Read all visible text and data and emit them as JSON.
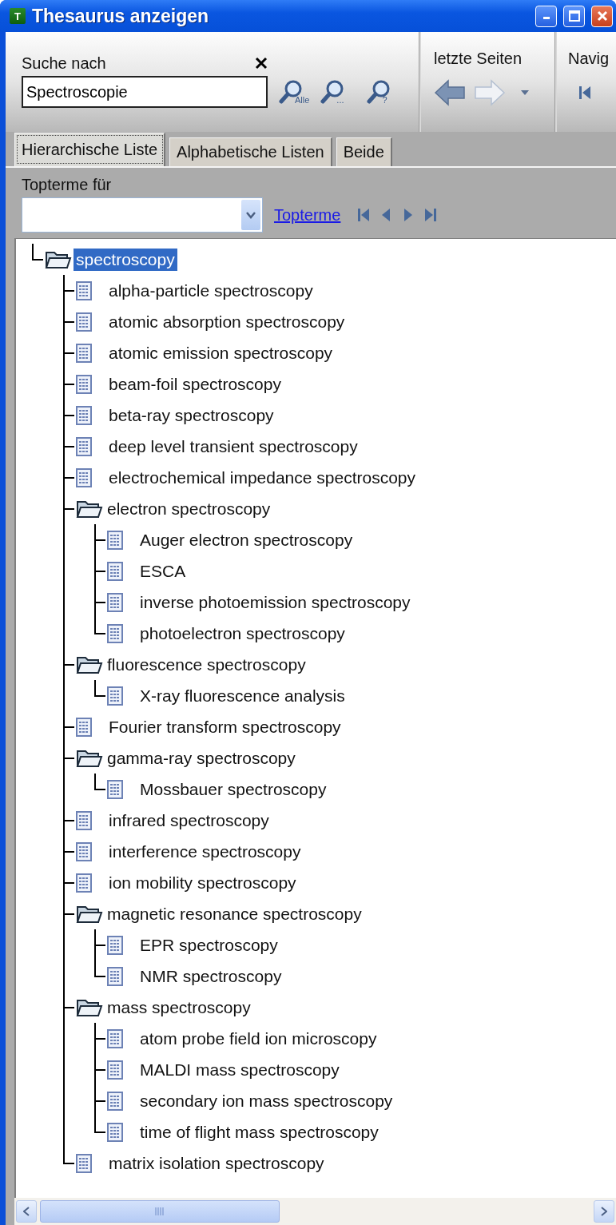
{
  "window": {
    "app_icon_letter": "T",
    "title": "Thesaurus anzeigen"
  },
  "search": {
    "label": "Suche nach",
    "value": "Spectroscopie",
    "buttons": [
      {
        "caption": "Alle"
      },
      {
        "caption": "..."
      },
      {
        "caption": "?"
      }
    ]
  },
  "recent_pages": {
    "label": "letzte Seiten",
    "back_disabled": false,
    "forward_disabled": true
  },
  "navigation": {
    "label": "Navig"
  },
  "tabs": [
    {
      "label": "Hierarchische Liste",
      "selected": true
    },
    {
      "label": "Alphabetische Listen",
      "selected": false
    },
    {
      "label": "Beide",
      "selected": false
    }
  ],
  "topterms": {
    "label": "Topterme für",
    "link": "Topterme"
  },
  "tree": [
    {
      "label": "spectroscopy",
      "kind": "folder",
      "selected": true,
      "children": [
        {
          "label": "alpha-particle spectroscopy",
          "kind": "term",
          "selected": false
        },
        {
          "label": "atomic absorption spectroscopy",
          "kind": "term",
          "selected": false
        },
        {
          "label": "atomic emission spectroscopy",
          "kind": "term",
          "selected": false
        },
        {
          "label": "beam-foil spectroscopy",
          "kind": "term",
          "selected": false
        },
        {
          "label": "beta-ray spectroscopy",
          "kind": "term",
          "selected": false
        },
        {
          "label": "deep level transient spectroscopy",
          "kind": "term",
          "selected": false
        },
        {
          "label": "electrochemical impedance spectroscopy",
          "kind": "term",
          "selected": false
        },
        {
          "label": "electron spectroscopy",
          "kind": "folder",
          "selected": false,
          "children": [
            {
              "label": "Auger electron spectroscopy",
              "kind": "term",
              "selected": false
            },
            {
              "label": "ESCA",
              "kind": "term",
              "selected": false
            },
            {
              "label": "inverse photoemission spectroscopy",
              "kind": "term",
              "selected": false
            },
            {
              "label": "photoelectron spectroscopy",
              "kind": "term",
              "selected": false
            }
          ]
        },
        {
          "label": "fluorescence spectroscopy",
          "kind": "folder",
          "selected": false,
          "children": [
            {
              "label": "X-ray fluorescence analysis",
              "kind": "term",
              "selected": false
            }
          ]
        },
        {
          "label": "Fourier transform spectroscopy",
          "kind": "term",
          "selected": false
        },
        {
          "label": "gamma-ray spectroscopy",
          "kind": "folder",
          "selected": false,
          "children": [
            {
              "label": "Mossbauer spectroscopy",
              "kind": "term",
              "selected": false
            }
          ]
        },
        {
          "label": "infrared spectroscopy",
          "kind": "term",
          "selected": false
        },
        {
          "label": "interference spectroscopy",
          "kind": "term",
          "selected": false
        },
        {
          "label": "ion mobility spectroscopy",
          "kind": "term",
          "selected": false
        },
        {
          "label": "magnetic resonance spectroscopy",
          "kind": "folder",
          "selected": false,
          "children": [
            {
              "label": "EPR spectroscopy",
              "kind": "term",
              "selected": false
            },
            {
              "label": "NMR spectroscopy",
              "kind": "term",
              "selected": false
            }
          ]
        },
        {
          "label": "mass spectroscopy",
          "kind": "folder",
          "selected": false,
          "children": [
            {
              "label": "atom probe field ion microscopy",
              "kind": "term",
              "selected": false
            },
            {
              "label": "MALDI mass spectroscopy",
              "kind": "term",
              "selected": false
            },
            {
              "label": "secondary ion mass spectroscopy",
              "kind": "term",
              "selected": false
            },
            {
              "label": "time of flight mass spectroscopy",
              "kind": "term",
              "selected": false
            }
          ]
        },
        {
          "label": "matrix isolation spectroscopy",
          "kind": "term",
          "selected": false
        }
      ]
    }
  ]
}
